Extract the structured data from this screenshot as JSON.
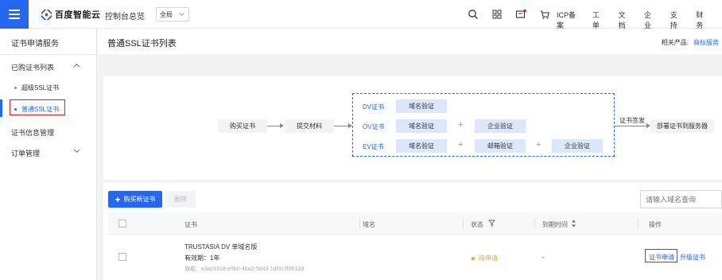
{
  "header": {
    "brand": "百度智能云",
    "console_label": "控制台总览",
    "region": "全局",
    "icons": [
      "search-icon",
      "grid-icon",
      "message-icon",
      "cart-icon"
    ],
    "links": [
      "ICP备案",
      "工单",
      "文档",
      "企业",
      "支持",
      "财务"
    ],
    "brand_color": "#2468f2"
  },
  "sidebar": {
    "title": "证书申请服务",
    "groups": [
      {
        "label": "已购证书列表",
        "items": [
          "超级SSL证书",
          "普通SSL证书"
        ]
      },
      {
        "label": "证书信息管理"
      },
      {
        "label": "订单管理"
      }
    ]
  },
  "page": {
    "title": "普通SSL证书列表",
    "related_label": "相关产品:",
    "related_link": "商标服务"
  },
  "flow": {
    "buy": "购买证书",
    "submit": "提交材料",
    "types": [
      "DV证书",
      "OV证书",
      "EV证书"
    ],
    "domain_verify": "域名验证",
    "company_verify": "企业验证",
    "email_verify": "邮箱验证",
    "plus": "+",
    "issue": "证书签发",
    "deploy": "部署证书到服务器"
  },
  "toolbar": {
    "buy_button": "购买新证书",
    "delete_button": "删除",
    "search_placeholder": "请输入域名查询"
  },
  "table": {
    "columns": [
      "证书",
      "域名",
      "状态",
      "到期时间",
      "操作"
    ],
    "rows": [
      {
        "cert_name": "TRUSTASIA DV 单域名版",
        "validity": "有效期：1年",
        "cert_id": "旗舰：e3ac9318-e5b0-46a2-9d43-1df3c7f96133",
        "domain": "",
        "status": "待申请",
        "expiry": "-",
        "action_apply": "证书申请",
        "action_upgrade": "升级证书"
      }
    ]
  }
}
